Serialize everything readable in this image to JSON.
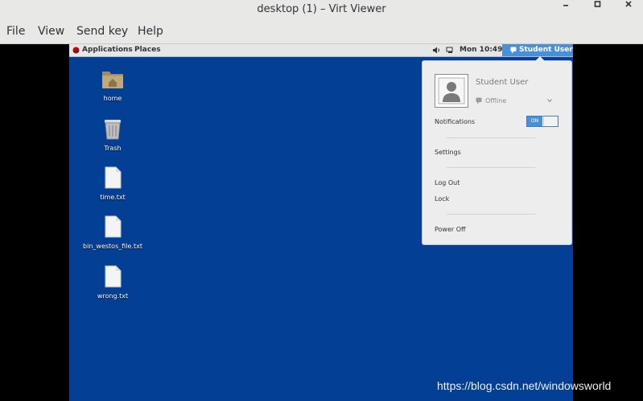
{
  "window": {
    "title": "desktop (1) – Virt Viewer"
  },
  "menubar": {
    "items": [
      "File",
      "View",
      "Send key",
      "Help"
    ]
  },
  "topbar": {
    "applications": "Applications",
    "places": "Places",
    "clock": "Mon 10:49",
    "user": "Student User"
  },
  "desktop": {
    "icons": [
      {
        "label": "home",
        "icon": "folder-home-icon"
      },
      {
        "label": "Trash",
        "icon": "trash-icon"
      },
      {
        "label": "time.txt",
        "icon": "text-file-icon"
      },
      {
        "label": "bin_westos_file.txt",
        "icon": "text-file-icon"
      },
      {
        "label": "wrong.txt",
        "icon": "text-file-icon"
      }
    ]
  },
  "user_menu": {
    "name": "Student User",
    "status": "Offline",
    "notifications_label": "Notifications",
    "notifications_toggle": "ON",
    "settings": "Settings",
    "log_out": "Log Out",
    "lock": "Lock",
    "power_off": "Power Off"
  },
  "watermark": "https://blog.csdn.net/windowsworld",
  "colors": {
    "desktop_bg": "#033f95",
    "accent": "#4a90d9"
  }
}
